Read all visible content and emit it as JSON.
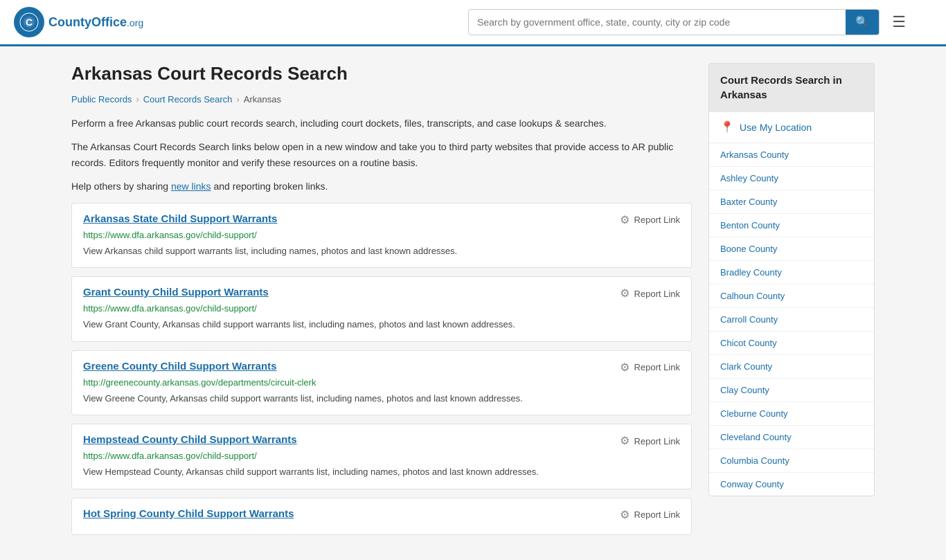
{
  "header": {
    "logo_text": "CountyOffice",
    "logo_org": ".org",
    "search_placeholder": "Search by government office, state, county, city or zip code",
    "search_icon": "🔍",
    "menu_icon": "☰"
  },
  "page": {
    "title": "Arkansas Court Records Search",
    "breadcrumb": [
      {
        "label": "Public Records",
        "href": "#"
      },
      {
        "label": "Court Records Search",
        "href": "#"
      },
      {
        "label": "Arkansas",
        "href": "#"
      }
    ],
    "description1": "Perform a free Arkansas public court records search, including court dockets, files, transcripts, and case lookups & searches.",
    "description2": "The Arkansas Court Records Search links below open in a new window and take you to third party websites that provide access to AR public records. Editors frequently monitor and verify these resources on a routine basis.",
    "description3_pre": "Help others by sharing ",
    "description3_link": "new links",
    "description3_post": " and reporting broken links."
  },
  "results": [
    {
      "title": "Arkansas State Child Support Warrants",
      "url": "https://www.dfa.arkansas.gov/child-support/",
      "description": "View Arkansas child support warrants list, including names, photos and last known addresses.",
      "report_label": "Report Link"
    },
    {
      "title": "Grant County Child Support Warrants",
      "url": "https://www.dfa.arkansas.gov/child-support/",
      "description": "View Grant County, Arkansas child support warrants list, including names, photos and last known addresses.",
      "report_label": "Report Link"
    },
    {
      "title": "Greene County Child Support Warrants",
      "url": "http://greenecounty.arkansas.gov/departments/circuit-clerk",
      "description": "View Greene County, Arkansas child support warrants list, including names, photos and last known addresses.",
      "report_label": "Report Link"
    },
    {
      "title": "Hempstead County Child Support Warrants",
      "url": "https://www.dfa.arkansas.gov/child-support/",
      "description": "View Hempstead County, Arkansas child support warrants list, including names, photos and last known addresses.",
      "report_label": "Report Link"
    },
    {
      "title": "Hot Spring County Child Support Warrants",
      "url": "",
      "description": "",
      "report_label": "Report Link"
    }
  ],
  "sidebar": {
    "header": "Court Records Search in Arkansas",
    "location_label": "Use My Location",
    "counties": [
      "Arkansas County",
      "Ashley County",
      "Baxter County",
      "Benton County",
      "Boone County",
      "Bradley County",
      "Calhoun County",
      "Carroll County",
      "Chicot County",
      "Clark County",
      "Clay County",
      "Cleburne County",
      "Cleveland County",
      "Columbia County",
      "Conway County"
    ]
  }
}
